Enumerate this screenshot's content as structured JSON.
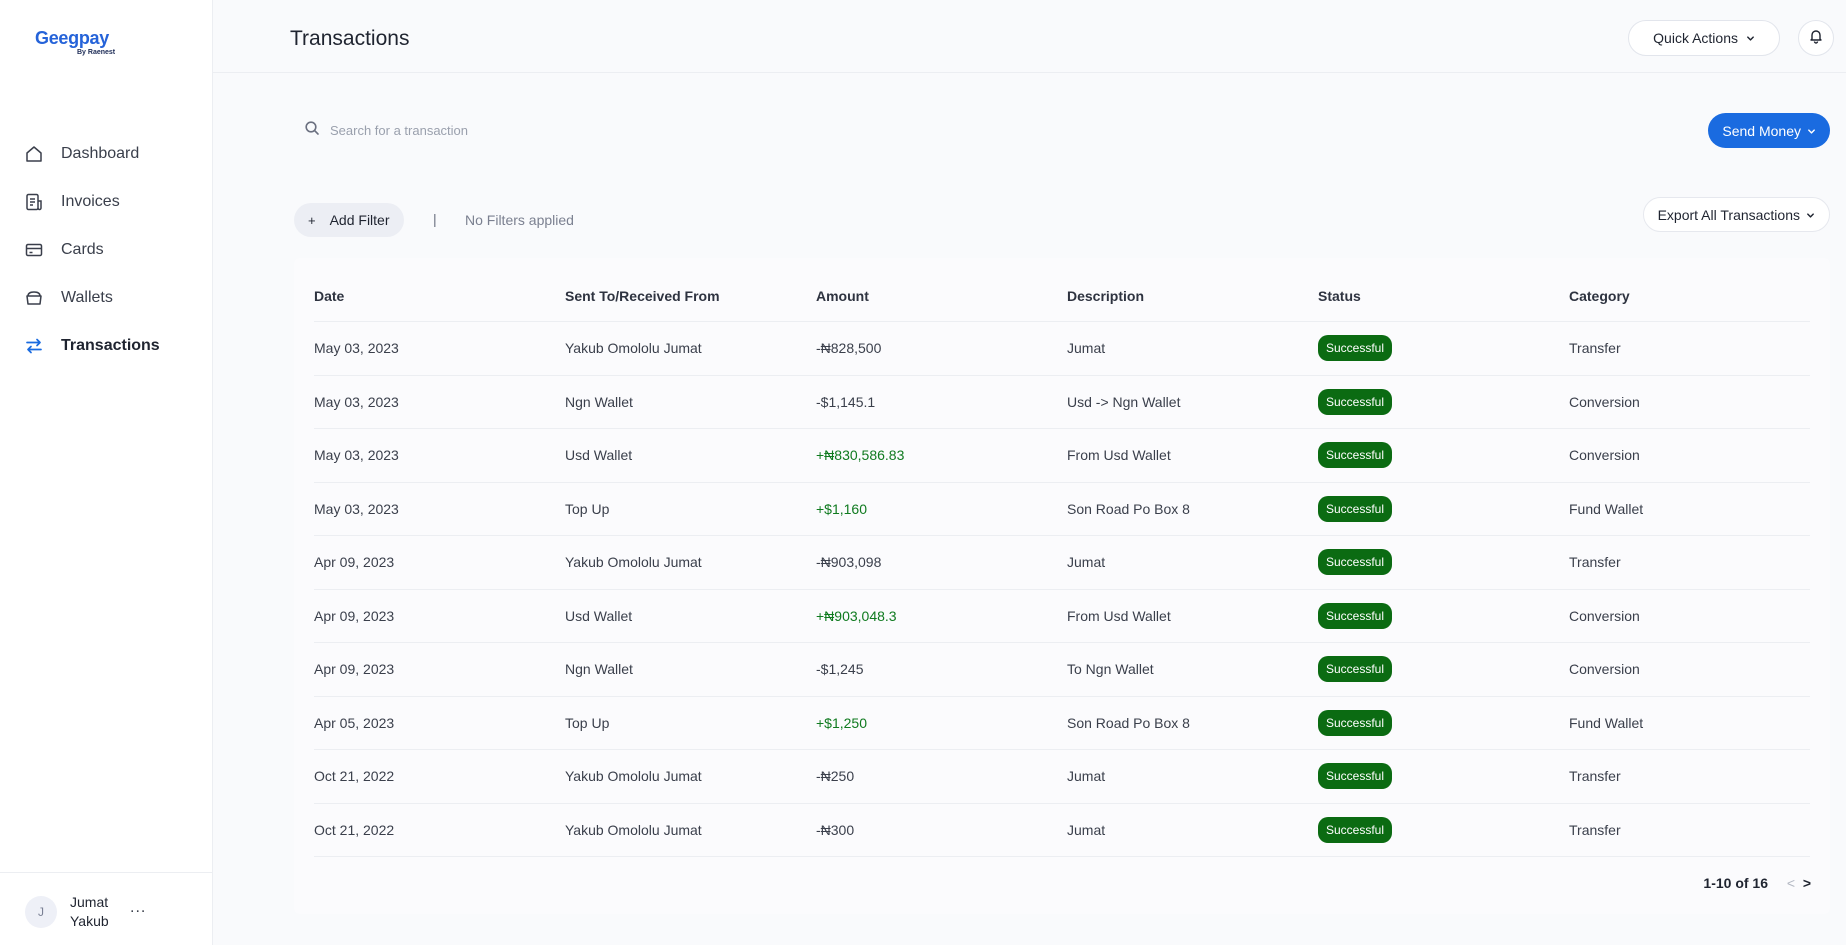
{
  "brand": {
    "name": "Geegpay",
    "sub": "By Raenest"
  },
  "sidebar": {
    "items": [
      {
        "label": "Dashboard",
        "icon": "home-icon"
      },
      {
        "label": "Invoices",
        "icon": "invoice-icon"
      },
      {
        "label": "Cards",
        "icon": "card-icon"
      },
      {
        "label": "Wallets",
        "icon": "wallet-icon"
      },
      {
        "label": "Transactions",
        "icon": "transactions-icon",
        "active": true
      }
    ],
    "user": {
      "initial": "J",
      "name": "Jumat Yakub",
      "menu": "..."
    }
  },
  "header": {
    "title": "Transactions",
    "quick_actions": "Quick Actions"
  },
  "search": {
    "placeholder": "Search for a transaction"
  },
  "actions": {
    "send_money": "Send Money",
    "add_filter": "Add Filter",
    "filter_separator": "|",
    "filter_status": "No Filters applied",
    "export": "Export All Transactions"
  },
  "table": {
    "columns": [
      "Date",
      "Sent To/Received From",
      "Amount",
      "Description",
      "Status",
      "Category"
    ],
    "rows": [
      {
        "date": "May 03, 2023",
        "party": "Yakub Omololu Jumat",
        "amount": "-₦828,500",
        "positive": false,
        "description": "Jumat",
        "status": "Successful",
        "category": "Transfer"
      },
      {
        "date": "May 03, 2023",
        "party": "Ngn Wallet",
        "amount": "-$1,145.1",
        "positive": false,
        "description": "Usd -> Ngn Wallet",
        "status": "Successful",
        "category": "Conversion"
      },
      {
        "date": "May 03, 2023",
        "party": "Usd Wallet",
        "amount": "+₦830,586.83",
        "positive": true,
        "description": "From Usd Wallet",
        "status": "Successful",
        "category": "Conversion"
      },
      {
        "date": "May 03, 2023",
        "party": "Top Up",
        "amount": "+$1,160",
        "positive": true,
        "description": "Son Road Po Box 8",
        "status": "Successful",
        "category": "Fund Wallet"
      },
      {
        "date": "Apr 09, 2023",
        "party": "Yakub Omololu Jumat",
        "amount": "-₦903,098",
        "positive": false,
        "description": "Jumat",
        "status": "Successful",
        "category": "Transfer"
      },
      {
        "date": "Apr 09, 2023",
        "party": "Usd Wallet",
        "amount": "+₦903,048.3",
        "positive": true,
        "description": "From Usd Wallet",
        "status": "Successful",
        "category": "Conversion"
      },
      {
        "date": "Apr 09, 2023",
        "party": "Ngn Wallet",
        "amount": "-$1,245",
        "positive": false,
        "description": "To Ngn Wallet",
        "status": "Successful",
        "category": "Conversion"
      },
      {
        "date": "Apr 05, 2023",
        "party": "Top Up",
        "amount": "+$1,250",
        "positive": true,
        "description": "Son Road Po Box 8",
        "status": "Successful",
        "category": "Fund Wallet"
      },
      {
        "date": "Oct 21, 2022",
        "party": "Yakub Omololu Jumat",
        "amount": "-₦250",
        "positive": false,
        "description": "Jumat",
        "status": "Successful",
        "category": "Transfer"
      },
      {
        "date": "Oct 21, 2022",
        "party": "Yakub Omololu Jumat",
        "amount": "-₦300",
        "positive": false,
        "description": "Jumat",
        "status": "Successful",
        "category": "Transfer"
      }
    ]
  },
  "pagination": {
    "info": "1-10 of 16",
    "prev": "<",
    "next": ">"
  },
  "colors": {
    "accent": "#1a6be0",
    "success": "#0b6b12",
    "positive_amount": "#0f7a1f"
  }
}
